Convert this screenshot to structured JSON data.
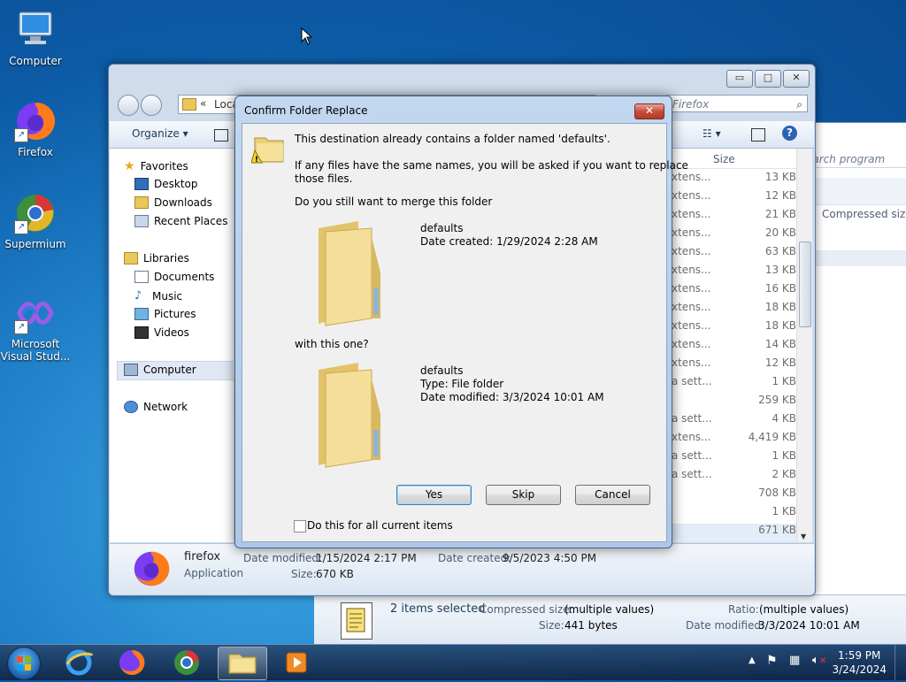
{
  "desktop": {
    "icons": [
      {
        "label": "Computer"
      },
      {
        "label": "Firefox"
      },
      {
        "label": "Supermium"
      },
      {
        "label": "Microsoft Visual Stud..."
      }
    ]
  },
  "explorer": {
    "window_controls": {
      "minimize": "▭",
      "maximize": "□",
      "close": "✕"
    },
    "address": {
      "chevron": "«",
      "path": "Loca"
    },
    "search_placeholder": "Search Firefox",
    "search_visible": "Firefox",
    "toolbar": {
      "organize": "Organize ▾"
    },
    "nav": {
      "favorites": "Favorites",
      "desktop": "Desktop",
      "downloads": "Downloads",
      "recent": "Recent Places",
      "libraries": "Libraries",
      "documents": "Documents",
      "music": "Music",
      "pictures": "Pictures",
      "videos": "Videos",
      "computer": "Computer",
      "network": "Network"
    },
    "size_header": "Size",
    "rows": [
      {
        "type": "xtens...",
        "size": "13 KB"
      },
      {
        "type": "xtens...",
        "size": "12 KB"
      },
      {
        "type": "xtens...",
        "size": "21 KB"
      },
      {
        "type": "xtens...",
        "size": "20 KB"
      },
      {
        "type": "xtens...",
        "size": "63 KB"
      },
      {
        "type": "xtens...",
        "size": "13 KB"
      },
      {
        "type": "xtens...",
        "size": "16 KB"
      },
      {
        "type": "xtens...",
        "size": "18 KB"
      },
      {
        "type": "xtens...",
        "size": "18 KB"
      },
      {
        "type": "xtens...",
        "size": "14 KB"
      },
      {
        "type": "xtens...",
        "size": "12 KB"
      },
      {
        "type": "a sett...",
        "size": "1 KB"
      },
      {
        "type": "",
        "size": "259 KB"
      },
      {
        "type": "a sett...",
        "size": "4 KB"
      },
      {
        "type": "xtens...",
        "size": "4,419 KB"
      },
      {
        "type": "a sett...",
        "size": "1 KB"
      },
      {
        "type": "a sett...",
        "size": "2 KB"
      },
      {
        "type": "",
        "size": "708 KB"
      },
      {
        "type": "",
        "size": "1 KB"
      },
      {
        "type": "",
        "size": "671 KB"
      }
    ],
    "details": {
      "name": "firefox",
      "kind": "Application",
      "modified_label": "Date modified:",
      "modified_value": "1/15/2024 2:17 PM",
      "created_label": "Date created:",
      "created_value": "9/5/2023 4:50 PM",
      "size_label": "Size:",
      "size_value": "670 KB"
    }
  },
  "window2": {
    "search_text": "earch program",
    "compressed_size_header": "Compressed size",
    "status": {
      "items_selected": "2 items selected",
      "compressed_label": "Compressed size:",
      "compressed_value": "(multiple values)",
      "ratio_label": "Ratio:",
      "ratio_value": "(multiple values)",
      "size_label": "Size:",
      "size_value": "441 bytes",
      "modified_label": "Date modified:",
      "modified_value": "3/3/2024 10:01 AM"
    }
  },
  "dialog": {
    "title": "Confirm Folder Replace",
    "close_glyph": "✕",
    "line1": "This destination already contains a folder named 'defaults'.",
    "line2a": "If any files have the same names, you will be asked if you want to replace",
    "line2b": "those files.",
    "question": "Do you still want to merge this folder",
    "dest": {
      "name": "defaults",
      "created": "Date created: 1/29/2024 2:28 AM"
    },
    "with_this": "with this one?",
    "src": {
      "name": "defaults",
      "type": "Type: File folder",
      "modified": "Date modified: 3/3/2024 10:01 AM"
    },
    "buttons": {
      "yes": "Yes",
      "skip": "Skip",
      "cancel": "Cancel"
    },
    "checkbox_label": "Do this for all current items"
  },
  "taskbar": {
    "time": "1:59 PM",
    "date": "3/24/2024"
  }
}
